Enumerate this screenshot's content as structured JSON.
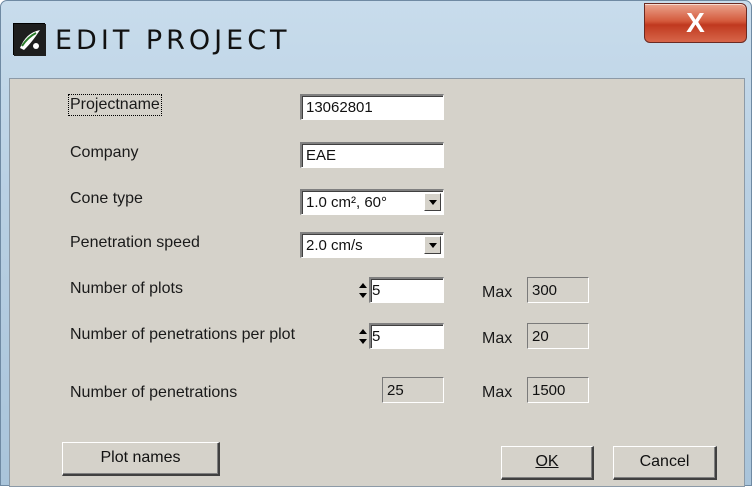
{
  "window": {
    "title": "EDIT PROJECT",
    "close_glyph": "X",
    "app_icon": "gecko-logo-icon"
  },
  "form": {
    "projectname_label": "Projectname",
    "projectname_value": "13062801",
    "company_label": "Company",
    "company_value": "EAE",
    "cone_type_label": "Cone type",
    "cone_type_value": "1.0  cm², 60°",
    "penetration_speed_label": "Penetration speed",
    "penetration_speed_value": "2.0 cm/s",
    "plots_label": "Number of plots",
    "plots_value": "5",
    "plots_max_label": "Max",
    "plots_max_value": "300",
    "per_plot_label": "Number of penetrations per plot",
    "per_plot_value": "5",
    "per_plot_max_label": "Max",
    "per_plot_max_value": "20",
    "total_label": "Number of penetrations",
    "total_value": "25",
    "total_max_label": "Max",
    "total_max_value": "1500"
  },
  "buttons": {
    "plot_names": "Plot names",
    "ok": "OK",
    "cancel": "Cancel"
  }
}
